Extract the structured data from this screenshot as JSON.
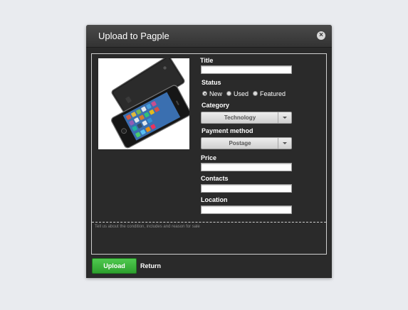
{
  "modal": {
    "title": "Upload to Pagple",
    "close_icon": "×"
  },
  "form": {
    "title_label": "Title",
    "status": {
      "label": "Status",
      "options": [
        "New",
        "Used",
        "Featured"
      ],
      "selected": "New"
    },
    "category": {
      "label": "Category",
      "value": "Technology"
    },
    "payment": {
      "label": "Payment method",
      "value": "Postage"
    },
    "price_label": "Price",
    "contacts_label": "Contacts",
    "location_label": "Location",
    "description_placeholder": "Tell us about the condition, includes and reason for sale"
  },
  "actions": {
    "upload_label": "Upload",
    "return_label": "Return"
  },
  "colors": {
    "modal_bg": "#2a2a2a",
    "upload_green": "#3cb43c",
    "page_bg": "#e9ebef"
  }
}
